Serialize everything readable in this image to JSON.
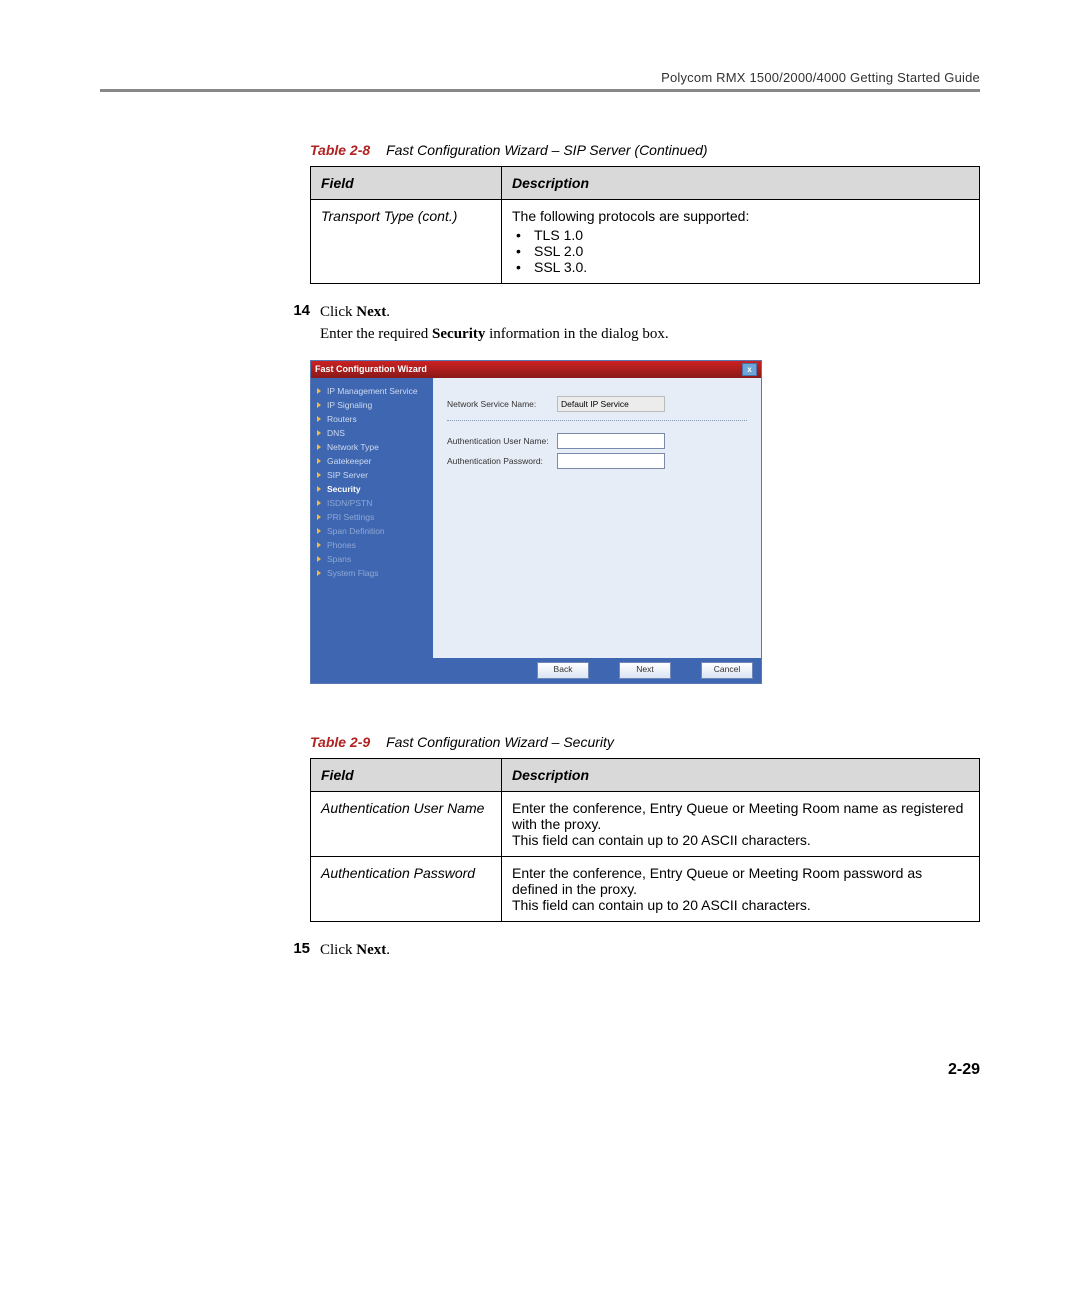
{
  "header": {
    "guide_title": "Polycom RMX 1500/2000/4000 Getting Started Guide"
  },
  "table1": {
    "caption_num": "Table 2-8",
    "caption_text": "Fast Configuration Wizard – SIP Server (Continued)",
    "head_field": "Field",
    "head_desc": "Description",
    "row_field": "Transport Type (cont.)",
    "row_intro": "The following protocols are supported:",
    "bullets": [
      "TLS 1.0",
      "SSL 2.0",
      "SSL 3.0."
    ]
  },
  "step14": {
    "num": "14",
    "line1_a": "Click ",
    "line1_b": "Next",
    "line1_c": ".",
    "line2_a": "Enter the required ",
    "line2_b": "Security",
    "line2_c": " information in the dialog box."
  },
  "dialog": {
    "title": "Fast Configuration Wizard",
    "nav": [
      {
        "label": "IP Management Service",
        "state": ""
      },
      {
        "label": "IP Signaling",
        "state": ""
      },
      {
        "label": "Routers",
        "state": ""
      },
      {
        "label": "DNS",
        "state": ""
      },
      {
        "label": "Network Type",
        "state": ""
      },
      {
        "label": "Gatekeeper",
        "state": ""
      },
      {
        "label": "SIP Server",
        "state": ""
      },
      {
        "label": "Security",
        "state": "active"
      },
      {
        "label": "ISDN/PSTN",
        "state": "muted"
      },
      {
        "label": "PRI Settings",
        "state": "muted"
      },
      {
        "label": "Span Definition",
        "state": "muted"
      },
      {
        "label": "Phones",
        "state": "muted"
      },
      {
        "label": "Spans",
        "state": "muted"
      },
      {
        "label": "System Flags",
        "state": "muted"
      }
    ],
    "lbl_service": "Network Service Name:",
    "val_service": "Default IP Service",
    "lbl_user": "Authentication User Name:",
    "lbl_pass": "Authentication Password:",
    "btn_back": "Back",
    "btn_next": "Next",
    "btn_cancel": "Cancel"
  },
  "table2": {
    "caption_num": "Table 2-9",
    "caption_text": "Fast Configuration Wizard – Security",
    "head_field": "Field",
    "head_desc": "Description",
    "rows": [
      {
        "field": "Authentication User Name",
        "desc": "Enter the conference, Entry Queue or Meeting Room name as registered with the proxy.\nThis field can contain up to 20 ASCII characters."
      },
      {
        "field": "Authentication Password",
        "desc": "Enter the conference, Entry Queue or Meeting Room password as defined in the proxy.\nThis field can contain up to 20 ASCII characters."
      }
    ]
  },
  "step15": {
    "num": "15",
    "line_a": "Click ",
    "line_b": "Next",
    "line_c": "."
  },
  "footer": {
    "page": "2-29"
  }
}
